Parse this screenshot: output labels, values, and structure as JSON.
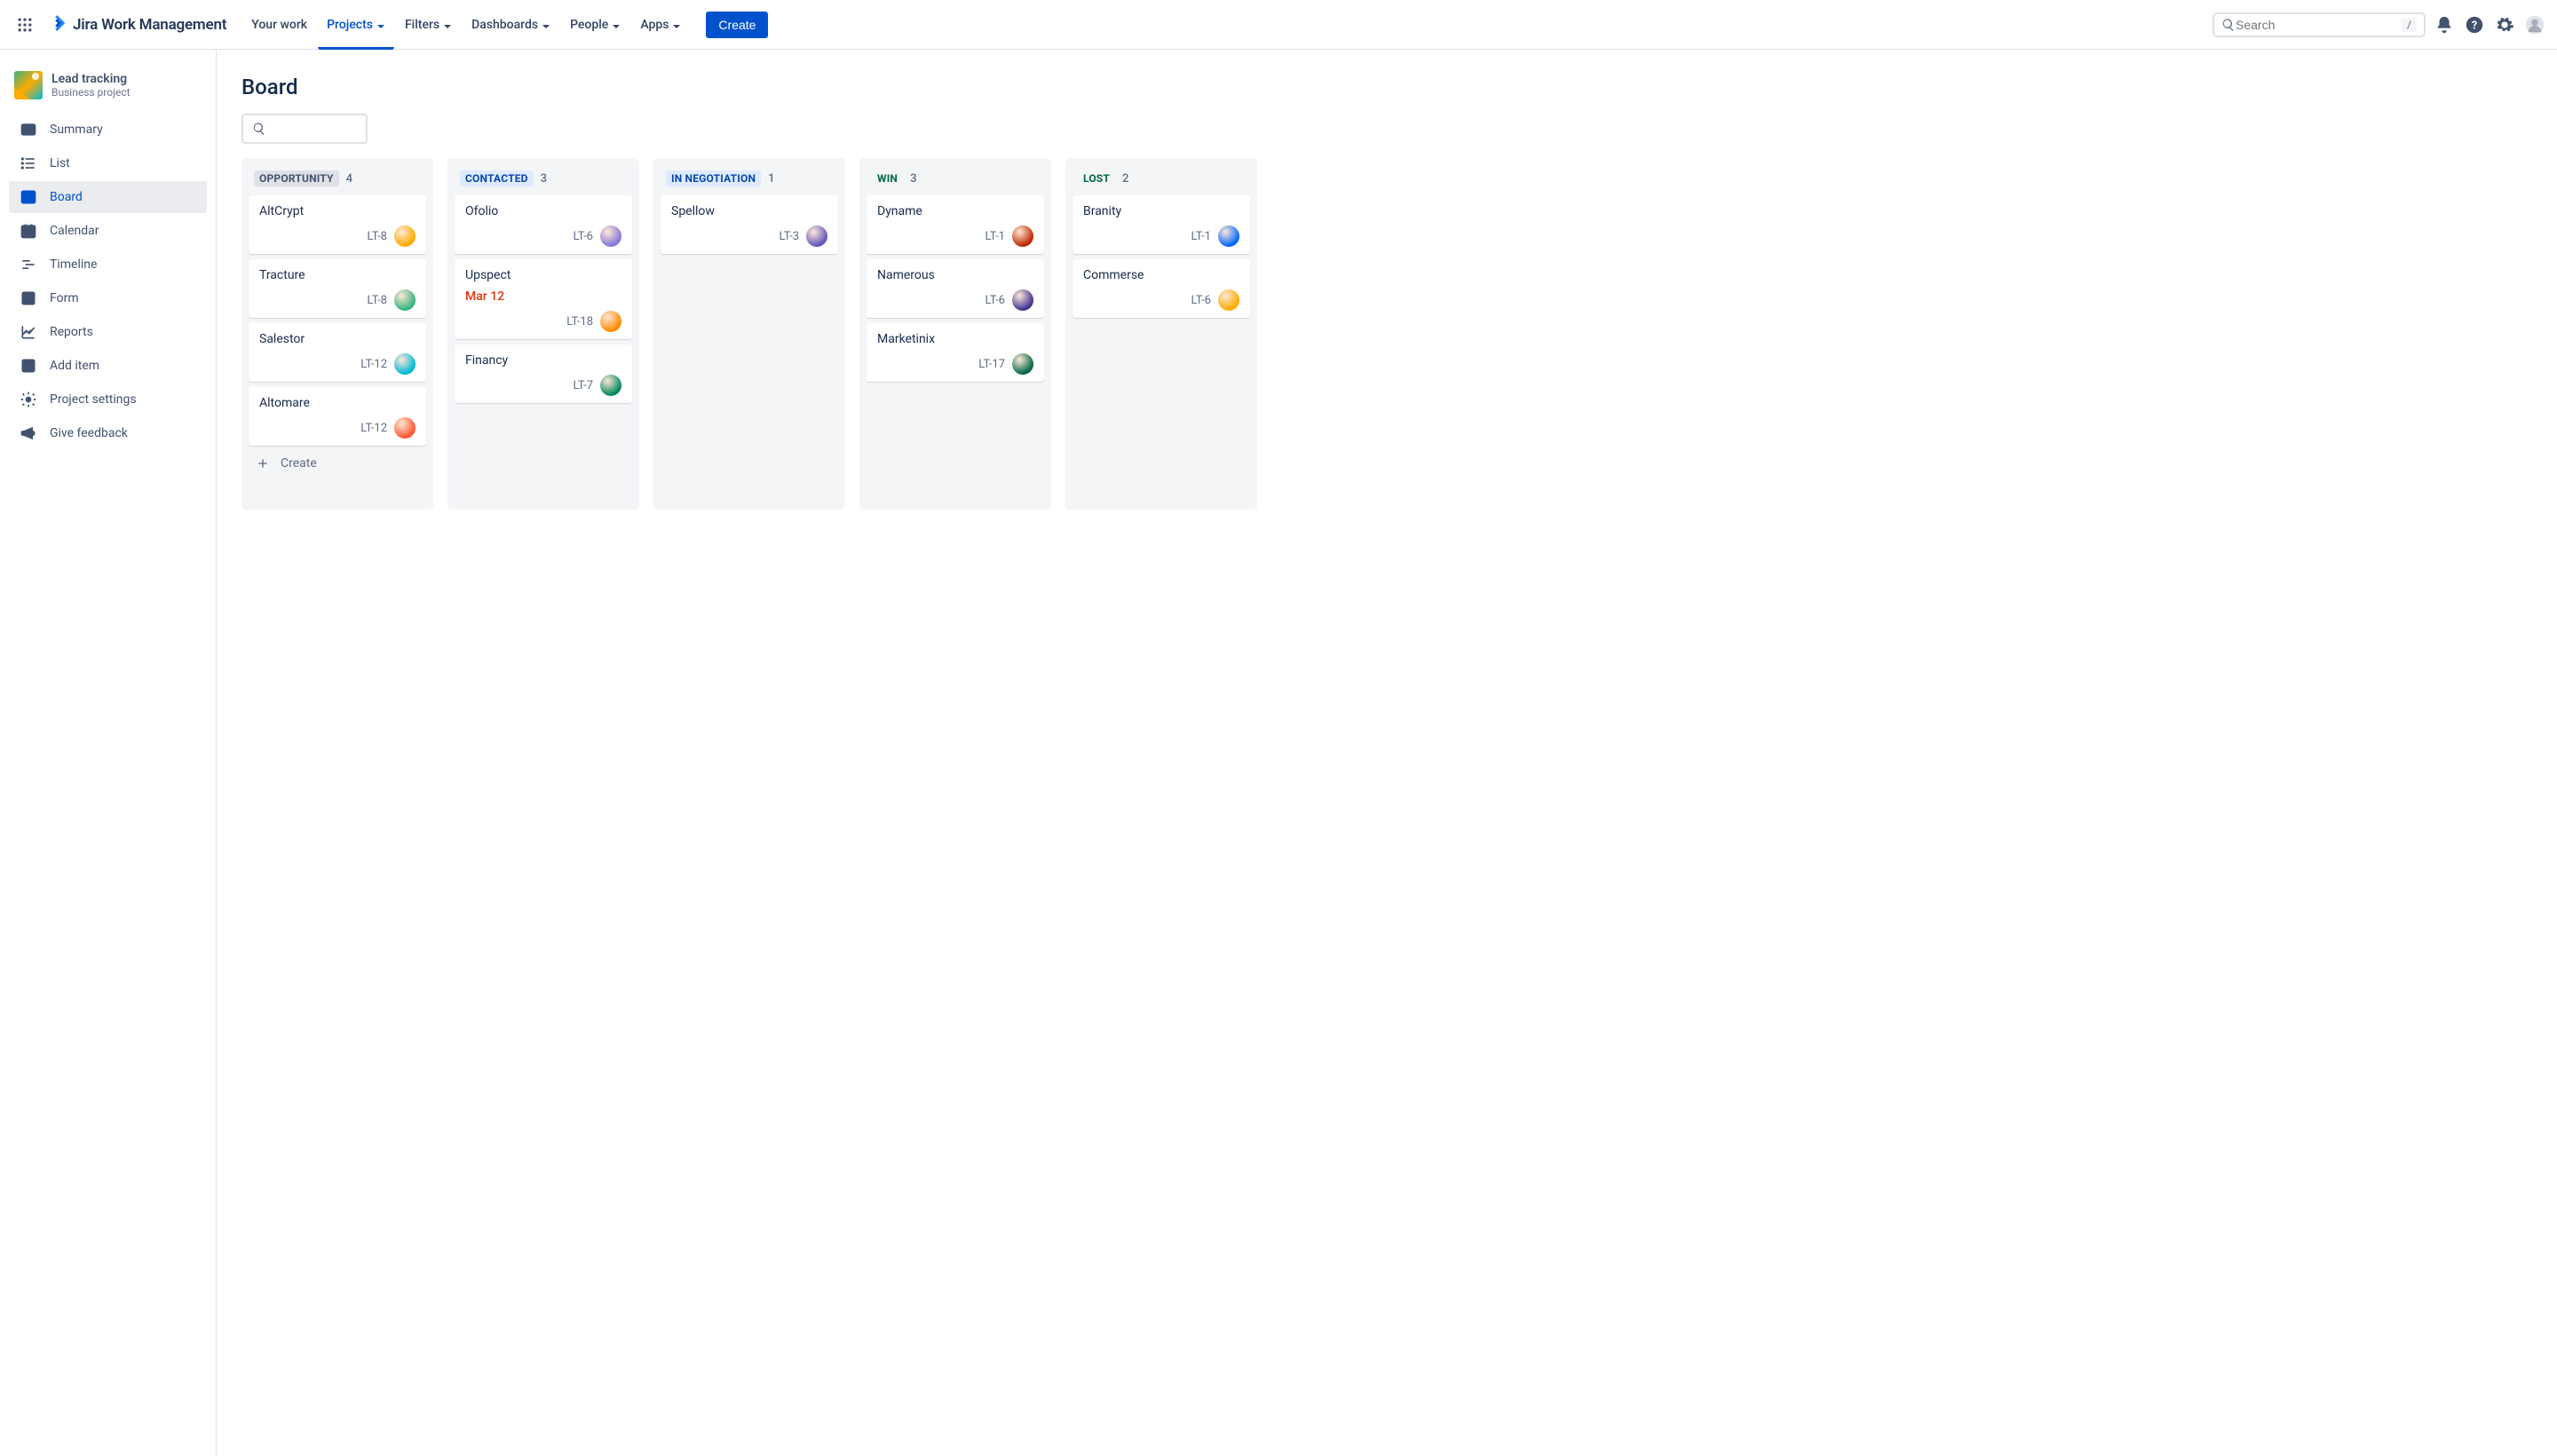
{
  "app": {
    "name": "Jira Work Management"
  },
  "nav": {
    "yourWork": "Your work",
    "projects": "Projects",
    "filters": "Filters",
    "dashboards": "Dashboards",
    "people": "People",
    "apps": "Apps",
    "create": "Create"
  },
  "search": {
    "placeholder": "Search",
    "hotkey": "/"
  },
  "project": {
    "name": "Lead tracking",
    "type": "Business project"
  },
  "sidebar": {
    "summary": "Summary",
    "list": "List",
    "board": "Board",
    "calendar": "Calendar",
    "timeline": "Timeline",
    "form": "Form",
    "reports": "Reports",
    "addItem": "Add item",
    "settings": "Project settings",
    "feedback": "Give feedback"
  },
  "page": {
    "title": "Board",
    "createLabel": "Create"
  },
  "columns": [
    {
      "name": "OPPORTUNITY",
      "count": "4",
      "tag": "tag-grey",
      "showCreate": true,
      "cards": [
        {
          "title": "AltCrypt",
          "key": "LT-8",
          "avatar": "#FFAB00"
        },
        {
          "title": "Tracture",
          "key": "LT-8",
          "avatar": "#36B37E"
        },
        {
          "title": "Salestor",
          "key": "LT-12",
          "avatar": "#00B8D9"
        },
        {
          "title": "Altomare",
          "key": "LT-12",
          "avatar": "#FF5630"
        }
      ]
    },
    {
      "name": "CONTACTED",
      "count": "3",
      "tag": "tag-blue",
      "cards": [
        {
          "title": "Ofolio",
          "key": "LT-6",
          "avatar": "#8777D9"
        },
        {
          "title": "Upspect",
          "due": "Mar 12",
          "key": "LT-18",
          "avatar": "#FF8B00"
        },
        {
          "title": "Financy",
          "key": "LT-7",
          "avatar": "#00875A"
        }
      ]
    },
    {
      "name": "IN NEGOTIATION",
      "count": "1",
      "tag": "tag-blue",
      "cards": [
        {
          "title": "Spellow",
          "key": "LT-3",
          "avatar": "#6554C0"
        }
      ]
    },
    {
      "name": "WIN",
      "count": "3",
      "tag": "tag-green",
      "cards": [
        {
          "title": "Dyname",
          "key": "LT-1",
          "avatar": "#BF2600"
        },
        {
          "title": "Namerous",
          "key": "LT-6",
          "avatar": "#403294"
        },
        {
          "title": "Marketinix",
          "key": "LT-17",
          "avatar": "#006644"
        }
      ]
    },
    {
      "name": "LOST",
      "count": "2",
      "tag": "tag-green",
      "cards": [
        {
          "title": "Branity",
          "key": "LT-1",
          "avatar": "#0065FF"
        },
        {
          "title": "Commerse",
          "key": "LT-6",
          "avatar": "#FFAB00"
        }
      ]
    }
  ]
}
